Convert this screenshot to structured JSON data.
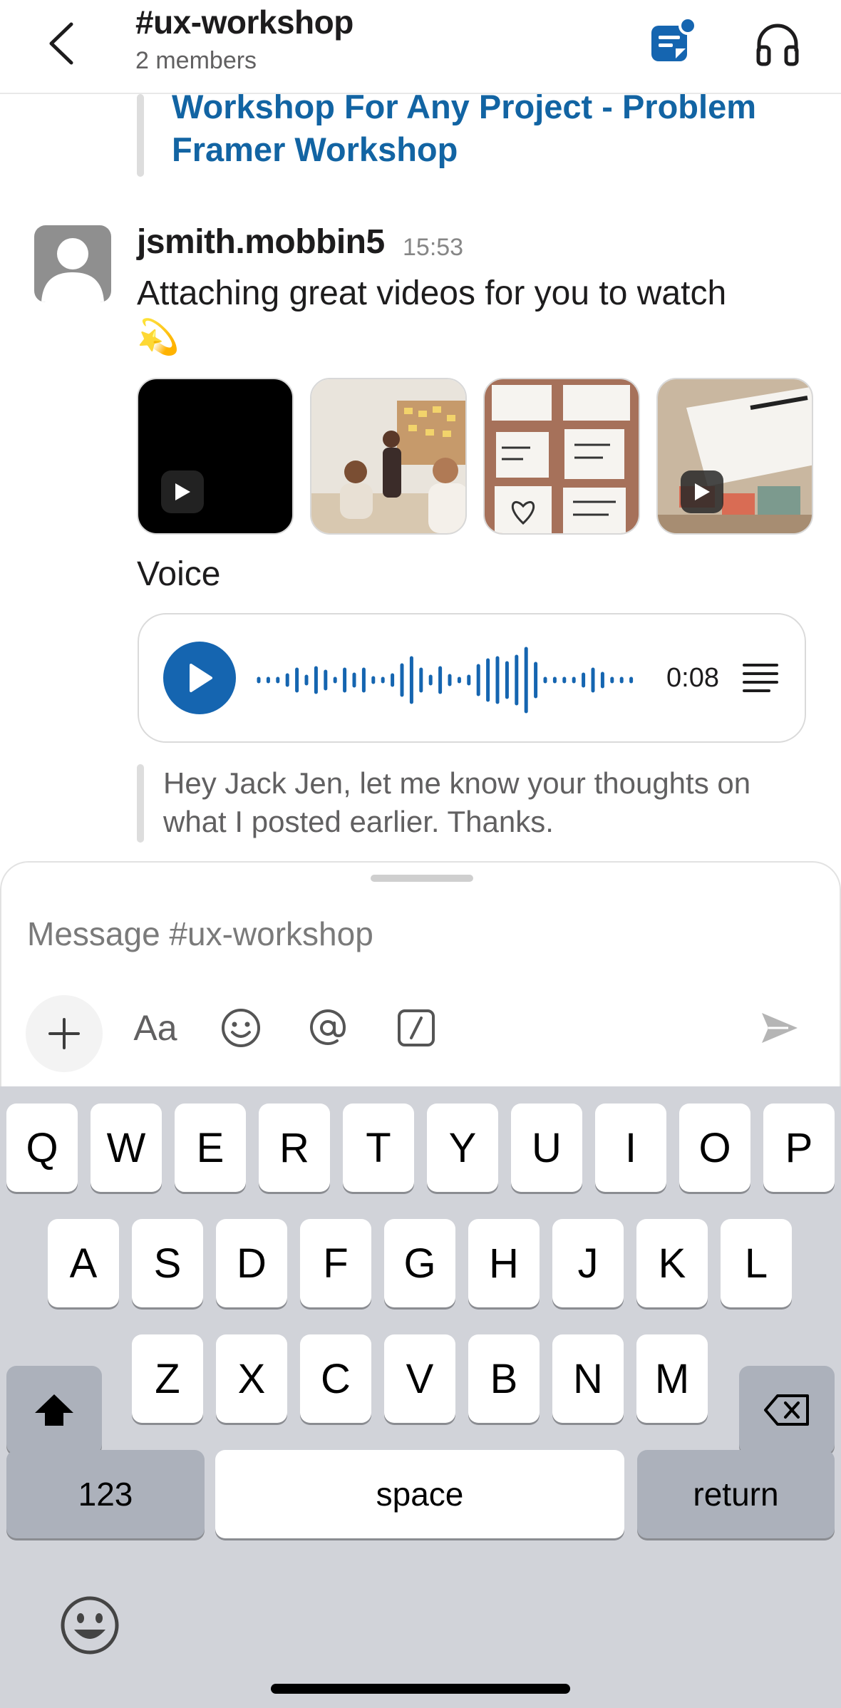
{
  "header": {
    "channel": "#ux-workshop",
    "members": "2 members"
  },
  "messages": {
    "link_title": "Workshop For Any Project - Problem Framer Workshop",
    "post": {
      "author": "jsmith.mobbin5",
      "time": "15:53",
      "text": "Attaching great videos for you to watch",
      "emoji": "💫",
      "attachments": [
        "video",
        "image",
        "image",
        "video"
      ],
      "voice_label": "Voice",
      "voice_duration": "0:08"
    },
    "reply_preview": "Hey Jack Jen, let me know your thoughts on what I posted earlier. Thanks."
  },
  "composer": {
    "placeholder": "Message #ux-workshop",
    "text_format_label": "Aa",
    "tools": [
      "plus-icon",
      "text-format-icon",
      "emoji-icon",
      "mention-icon",
      "slash-command-icon",
      "send-icon"
    ]
  },
  "keyboard": {
    "row1": [
      "Q",
      "W",
      "E",
      "R",
      "T",
      "Y",
      "U",
      "I",
      "O",
      "P"
    ],
    "row2": [
      "A",
      "S",
      "D",
      "F",
      "G",
      "H",
      "J",
      "K",
      "L"
    ],
    "row3": [
      "Z",
      "X",
      "C",
      "V",
      "B",
      "N",
      "M"
    ],
    "numbers_label": "123",
    "space_label": "space",
    "return_label": "return"
  },
  "colors": {
    "link": "#1264a3",
    "accent": "#1565b0",
    "keyboard_bg": "#d1d3d9"
  }
}
